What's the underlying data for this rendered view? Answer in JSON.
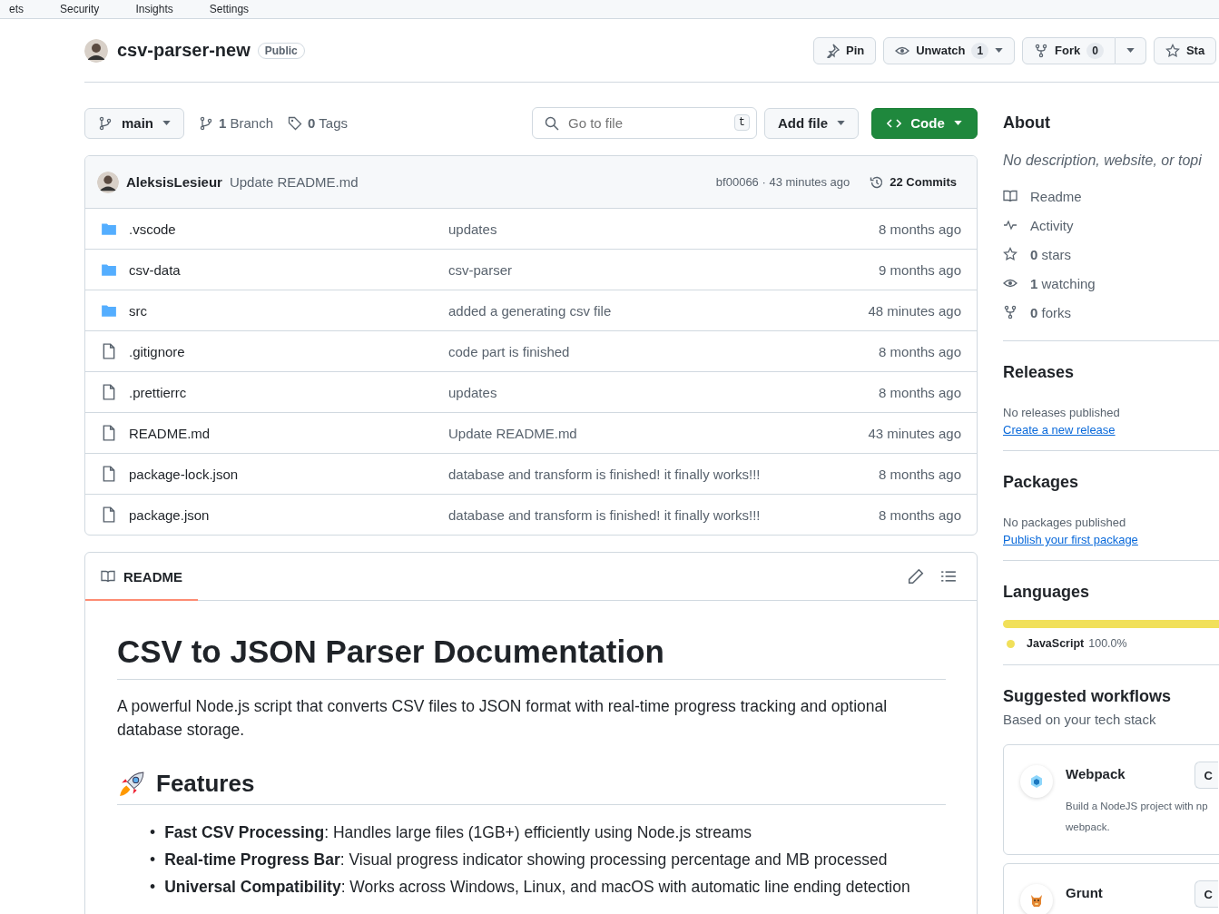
{
  "nav_tabs": [
    {
      "label": "ets"
    },
    {
      "label": "Security"
    },
    {
      "label": "Insights"
    },
    {
      "label": "Settings"
    }
  ],
  "repo": {
    "name": "csv-parser-new",
    "visibility": "Public"
  },
  "header_actions": {
    "pin": "Pin",
    "unwatch": "Unwatch",
    "watch_count": "1",
    "fork": "Fork",
    "fork_count": "0",
    "star": "Sta"
  },
  "toolbar": {
    "branch": "main",
    "branches": "**1** Branch",
    "tags": "**0** Tags",
    "search_placeholder": "Go to file",
    "shortcut": "t",
    "add_file": "Add file",
    "code": "Code"
  },
  "latest_commit": {
    "author": "AleksisLesieur",
    "message": "Update README.md",
    "sha_time": "bf00066 · 43 minutes ago",
    "commits": "22 Commits"
  },
  "files": [
    {
      "kind": "folder",
      "name": ".vscode",
      "message": "updates",
      "time": "8 months ago"
    },
    {
      "kind": "folder",
      "name": "csv-data",
      "message": "csv-parser",
      "time": "9 months ago"
    },
    {
      "kind": "folder",
      "name": "src",
      "message": "added a generating csv file",
      "time": "48 minutes ago"
    },
    {
      "kind": "file",
      "name": ".gitignore",
      "message": "code part is finished",
      "time": "8 months ago"
    },
    {
      "kind": "file",
      "name": ".prettierrc",
      "message": "updates",
      "time": "8 months ago"
    },
    {
      "kind": "file",
      "name": "README.md",
      "message": "Update README.md",
      "time": "43 minutes ago"
    },
    {
      "kind": "file",
      "name": "package-lock.json",
      "message": "database and transform is finished! it finally works!!!",
      "time": "8 months ago"
    },
    {
      "kind": "file",
      "name": "package.json",
      "message": "database and transform is finished! it finally works!!!",
      "time": "8 months ago"
    }
  ],
  "readme": {
    "tab": "README",
    "marker": "•",
    "title": "CSV to JSON Parser Documentation",
    "intro": "A powerful Node.js script that converts CSV files to JSON format with real-time progress tracking and optional database storage.",
    "features_heading": "Features",
    "features": [
      "**Fast CSV Processing**: Handles large files (1GB+) efficiently using Node.js streams",
      "**Real-time Progress Bar**: Visual progress indicator showing processing percentage and MB processed",
      "**Universal Compatibility**: Works across Windows, Linux, and macOS with automatic line ending detection"
    ]
  },
  "sidebar": {
    "about_title": "About",
    "about_text": "No description, website, or topi",
    "about_items": [
      {
        "kind": "book",
        "text": "Readme"
      },
      {
        "kind": "pulse",
        "text": "Activity"
      },
      {
        "kind": "star",
        "text": "**0** stars"
      },
      {
        "kind": "eye",
        "text": "**1** watching"
      },
      {
        "kind": "fork",
        "text": "**0** forks"
      }
    ],
    "releases_title": "Releases",
    "releases_text": "No releases published",
    "releases_link": "Create a new release",
    "packages_title": "Packages",
    "packages_text": "No packages published",
    "packages_link": "Publish your first package",
    "languages_title": "Languages",
    "languages": [
      {
        "name": "JavaScript",
        "percent": "100.0%",
        "color": "#f1e05a",
        "level": 1
      }
    ],
    "workflows_title": "Suggested workflows",
    "workflows_subtitle": "Based on your tech stack",
    "workflows": [
      {
        "kind": "webpack",
        "name": "Webpack",
        "button": "C",
        "description": [
          "Build a NodeJS project with np",
          "webpack."
        ]
      },
      {
        "kind": "grunt",
        "name": "Grunt",
        "button": "C"
      }
    ]
  }
}
